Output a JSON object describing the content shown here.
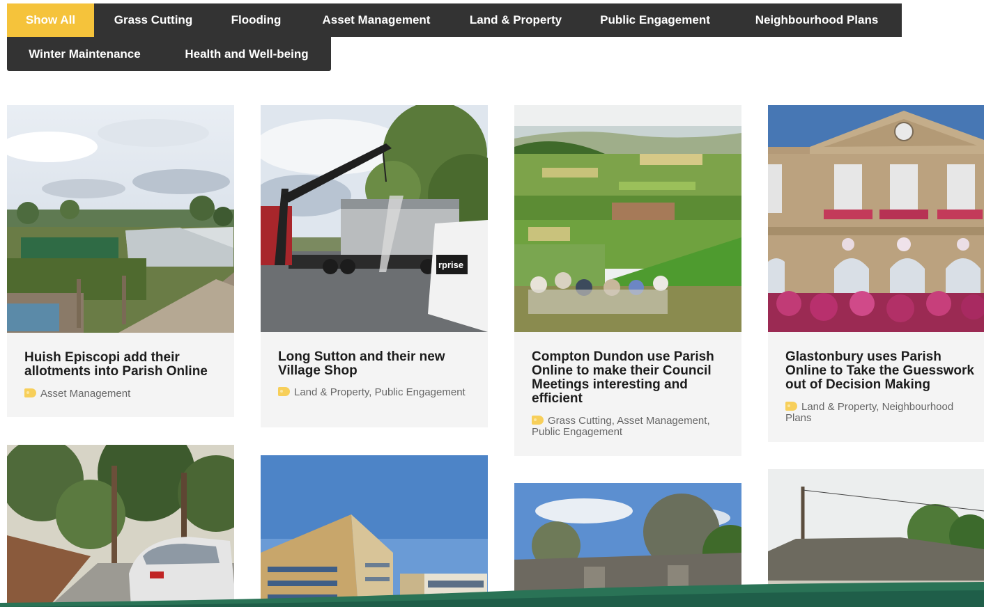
{
  "filters": {
    "items": [
      {
        "label": "Show All"
      },
      {
        "label": "Grass Cutting"
      },
      {
        "label": "Flooding"
      },
      {
        "label": "Asset Management"
      },
      {
        "label": "Land & Property"
      },
      {
        "label": "Public Engagement"
      },
      {
        "label": "Neighbourhood Plans"
      },
      {
        "label": "Winter Maintenance"
      },
      {
        "label": "Health and Well-being"
      }
    ],
    "active": "Show All",
    "active_color": "#f5c33b",
    "bar_color": "#333333"
  },
  "posts": [
    {
      "title": "Huish Episcopi add their allotments into Parish Online",
      "categories": "Asset Management",
      "image": "allotments-photo"
    },
    {
      "title": "Long Sutton and their new Village Shop",
      "categories": "Land & Property, Public Engagement",
      "image": "crane-lorry-photo"
    },
    {
      "title": "Compton Dundon use Parish Online to make their Council Meetings interesting and efficient",
      "categories": "Grass Cutting, Asset Management, Public Engagement",
      "image": "countryside-view-photo"
    },
    {
      "title": "Glastonbury uses Parish Online to Take the Guesswork out of Decision Making",
      "categories": "Land & Property, Neighbourhood Plans",
      "image": "town-hall-flowers-photo"
    }
  ],
  "more_posts": [
    {
      "image": "road-trees-car-photo"
    },
    {
      "image": "modern-building-photo"
    },
    {
      "image": "stone-bridge-photo"
    },
    {
      "image": "thatched-cottage-photo"
    }
  ],
  "colors": {
    "card_bg": "#f4f4f4",
    "tag_icon": "#f7cf5a",
    "footer_band": "#1f5e49"
  }
}
